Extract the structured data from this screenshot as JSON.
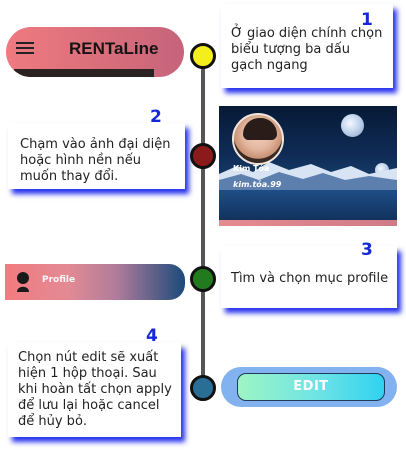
{
  "steps": [
    {
      "number": "1",
      "text": "Ở giao diện chính chọn biểu tượng ba dấu gạch ngang"
    },
    {
      "number": "2",
      "text": "Chạm vào ảnh đại diện hoặc hình  nền nếu muốn thay đổi."
    },
    {
      "number": "3",
      "text": "Tìm và chọn mục profile"
    },
    {
      "number": "4",
      "text": "Chọn nút edit sẽ xuất hiện 1 hộp thoại. Sau khi hoàn tất chọn apply để lưu lại hoặc cancel để hủy bỏ."
    }
  ],
  "appbar": {
    "title": "RENTaLine",
    "menu_icon": "hamburger-menu-icon"
  },
  "profile_preview": {
    "name": "Kim Tỏa",
    "handle": "kim.tỏa.99"
  },
  "profile_item": {
    "label": "Profile",
    "icon": "person-icon"
  },
  "edit_button": {
    "label": "EDIT"
  },
  "colors": {
    "node_1": "#f4ee1c",
    "node_2": "#8b1a1a",
    "node_3": "#227a1e",
    "node_4": "#2a6e96",
    "step_number": "#1527d6",
    "card_shadow": "#2833ee"
  }
}
